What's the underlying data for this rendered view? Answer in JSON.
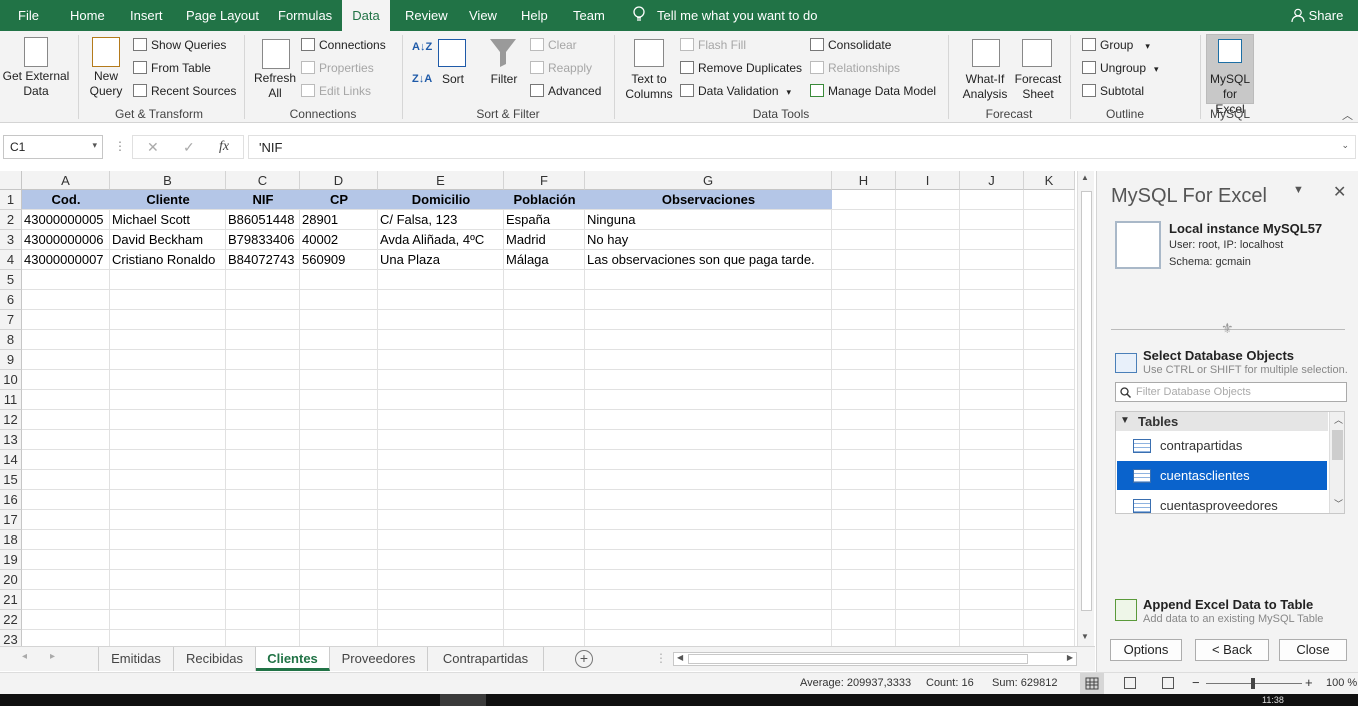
{
  "app": {
    "share": "Share"
  },
  "menu_tabs": [
    "File",
    "Home",
    "Insert",
    "Page Layout",
    "Formulas",
    "Data",
    "Review",
    "View",
    "Help",
    "Team"
  ],
  "tell_me": "Tell me what you want to do",
  "ribbon": {
    "get_external": "Get External Data",
    "get_transform": {
      "new_query": "New Query",
      "show_queries": "Show Queries",
      "from_table": "From Table",
      "recent_sources": "Recent Sources",
      "label": "Get & Transform"
    },
    "connections": {
      "refresh_all": "Refresh All",
      "connections": "Connections",
      "properties": "Properties",
      "edit_links": "Edit Links",
      "label": "Connections"
    },
    "sort_filter": {
      "az": "A↓Z",
      "za": "Z↓A",
      "sort": "Sort",
      "filter": "Filter",
      "clear": "Clear",
      "reapply": "Reapply",
      "advanced": "Advanced",
      "label": "Sort & Filter"
    },
    "data_tools": {
      "text_to_columns": "Text to Columns",
      "flash_fill": "Flash Fill",
      "remove_duplicates": "Remove Duplicates",
      "data_validation": "Data Validation",
      "consolidate": "Consolidate",
      "relationships": "Relationships",
      "manage_data_model": "Manage Data Model",
      "label": "Data Tools"
    },
    "forecast": {
      "what_if": "What-If Analysis",
      "forecast_sheet": "Forecast Sheet",
      "label": "Forecast"
    },
    "outline": {
      "group": "Group",
      "ungroup": "Ungroup",
      "subtotal": "Subtotal",
      "label": "Outline"
    },
    "mysql": {
      "button": "MySQL for Excel",
      "label": "MySQL"
    }
  },
  "formula_bar": {
    "name_box": "C1",
    "formula": "'NIF",
    "fx": "fx"
  },
  "sheet": {
    "columns": [
      "A",
      "B",
      "C",
      "D",
      "E",
      "F",
      "G",
      "H",
      "I",
      "J",
      "K"
    ],
    "rows": [
      "1",
      "2",
      "3",
      "4",
      "5",
      "6",
      "7",
      "8",
      "9",
      "10",
      "11",
      "12",
      "13",
      "14",
      "15",
      "16",
      "17",
      "18",
      "19",
      "20",
      "21",
      "22",
      "23"
    ],
    "header": [
      "Cod.",
      "Cliente",
      "NIF",
      "CP",
      "Domicilio",
      "Población",
      "Observaciones"
    ],
    "data": [
      [
        "43000000005",
        "Michael Scott",
        "B86051448",
        "28901",
        "C/ Falsa, 123",
        "España",
        "Ninguna"
      ],
      [
        "43000000006",
        "David Beckham",
        "B79833406",
        "40002",
        "Avda Aliñada, 4ºC",
        "Madrid",
        "No hay"
      ],
      [
        "43000000007",
        "Cristiano Ronaldo",
        "B84072743",
        "560909",
        "Una Plaza",
        "Málaga",
        "Las observaciones son que paga tarde."
      ]
    ]
  },
  "sheet_tabs": [
    "Emitidas",
    "Recibidas",
    "Clientes",
    "Proveedores",
    "Contrapartidas"
  ],
  "active_sheet": "Clientes",
  "status": {
    "average": "Average: 209937,3333",
    "count": "Count: 16",
    "sum": "Sum: 629812",
    "zoom": "100 %"
  },
  "mysql_pane": {
    "title": "MySQL For Excel",
    "connection": {
      "name": "Local instance MySQL57",
      "user": "User: root, IP: localhost",
      "schema": "Schema: gcmain"
    },
    "select_title": "Select Database Objects",
    "select_hint": "Use CTRL or SHIFT for multiple selection.",
    "filter_placeholder": "Filter Database Objects",
    "tables_label": "Tables",
    "tables": [
      "contrapartidas",
      "cuentasclientes",
      "cuentasproveedores"
    ],
    "selected_table": "cuentasclientes",
    "append_title": "Append Excel Data to Table",
    "append_hint": "Add data to an existing MySQL Table",
    "buttons": {
      "options": "Options",
      "back": "< Back",
      "close": "Close"
    }
  },
  "taskbar": {
    "time": "11:38"
  },
  "colors": {
    "excel_green": "#217346",
    "header_fill": "#b4c6e7",
    "selection_blue": "#0a63cc"
  }
}
